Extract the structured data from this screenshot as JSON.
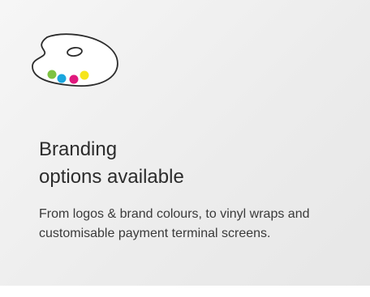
{
  "card": {
    "icon": "palette-icon",
    "title_line1": "Branding",
    "title_line2": "options available",
    "description": "From logos & brand colours, to vinyl wraps and customisable payment terminal screens."
  },
  "colors": {
    "background": "#ededed",
    "text": "#2c2c2c",
    "paint_green": "#7ec242",
    "paint_cyan": "#1aa6de",
    "paint_magenta": "#e0197d",
    "paint_yellow": "#f6e51c"
  }
}
